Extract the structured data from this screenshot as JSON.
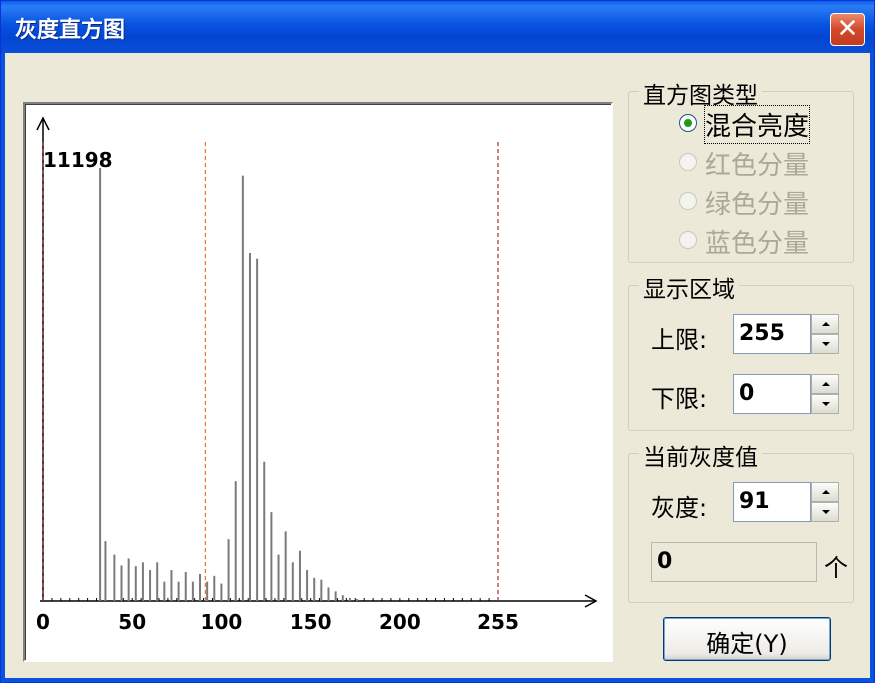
{
  "window": {
    "title": "灰度直方图",
    "close_label": "✕"
  },
  "chart_data": {
    "type": "bar",
    "x_ticks": [
      "0",
      "50",
      "100",
      "150",
      "200",
      "255"
    ],
    "max_label": "11198",
    "bars": [
      {
        "x": 32,
        "y": 11198
      },
      {
        "x": 35,
        "y": 1550
      },
      {
        "x": 40,
        "y": 1200
      },
      {
        "x": 44,
        "y": 920
      },
      {
        "x": 48,
        "y": 1100
      },
      {
        "x": 52,
        "y": 900
      },
      {
        "x": 56,
        "y": 1000
      },
      {
        "x": 60,
        "y": 800
      },
      {
        "x": 64,
        "y": 1000
      },
      {
        "x": 68,
        "y": 500
      },
      {
        "x": 72,
        "y": 800
      },
      {
        "x": 76,
        "y": 500
      },
      {
        "x": 80,
        "y": 750
      },
      {
        "x": 84,
        "y": 500
      },
      {
        "x": 88,
        "y": 700
      },
      {
        "x": 92,
        "y": 500
      },
      {
        "x": 96,
        "y": 650
      },
      {
        "x": 100,
        "y": 450
      },
      {
        "x": 104,
        "y": 1600
      },
      {
        "x": 108,
        "y": 3100
      },
      {
        "x": 112,
        "y": 11000
      },
      {
        "x": 116,
        "y": 9000
      },
      {
        "x": 120,
        "y": 8850
      },
      {
        "x": 124,
        "y": 3600
      },
      {
        "x": 128,
        "y": 2300
      },
      {
        "x": 132,
        "y": 1200
      },
      {
        "x": 136,
        "y": 1800
      },
      {
        "x": 140,
        "y": 1000
      },
      {
        "x": 144,
        "y": 1300
      },
      {
        "x": 148,
        "y": 800
      },
      {
        "x": 152,
        "y": 600
      },
      {
        "x": 156,
        "y": 550
      },
      {
        "x": 160,
        "y": 350
      },
      {
        "x": 164,
        "y": 250
      },
      {
        "x": 168,
        "y": 150
      },
      {
        "x": 172,
        "y": 80
      },
      {
        "x": 176,
        "y": 50
      }
    ],
    "lower_bound": 0,
    "upper_bound": 255,
    "current_gray": 91,
    "colors": {
      "bar": "#7a7a7a",
      "bound_line": "#a0302a",
      "current_line": "#f07020",
      "axis": "#000000"
    }
  },
  "type_group": {
    "title": "直方图类型",
    "options": [
      {
        "label": "混合亮度",
        "checked": true,
        "disabled": false
      },
      {
        "label": "红色分量",
        "checked": false,
        "disabled": true
      },
      {
        "label": "绿色分量",
        "checked": false,
        "disabled": true
      },
      {
        "label": "蓝色分量",
        "checked": false,
        "disabled": true
      }
    ]
  },
  "range_group": {
    "title": "显示区域",
    "upper_label": "上限:",
    "upper_value": "255",
    "lower_label": "下限:",
    "lower_value": "0"
  },
  "gray_group": {
    "title": "当前灰度值",
    "gray_label": "灰度:",
    "gray_value": "91",
    "count_value": "0",
    "count_unit": "个"
  },
  "ok_button": {
    "label": "确定(Y)"
  }
}
